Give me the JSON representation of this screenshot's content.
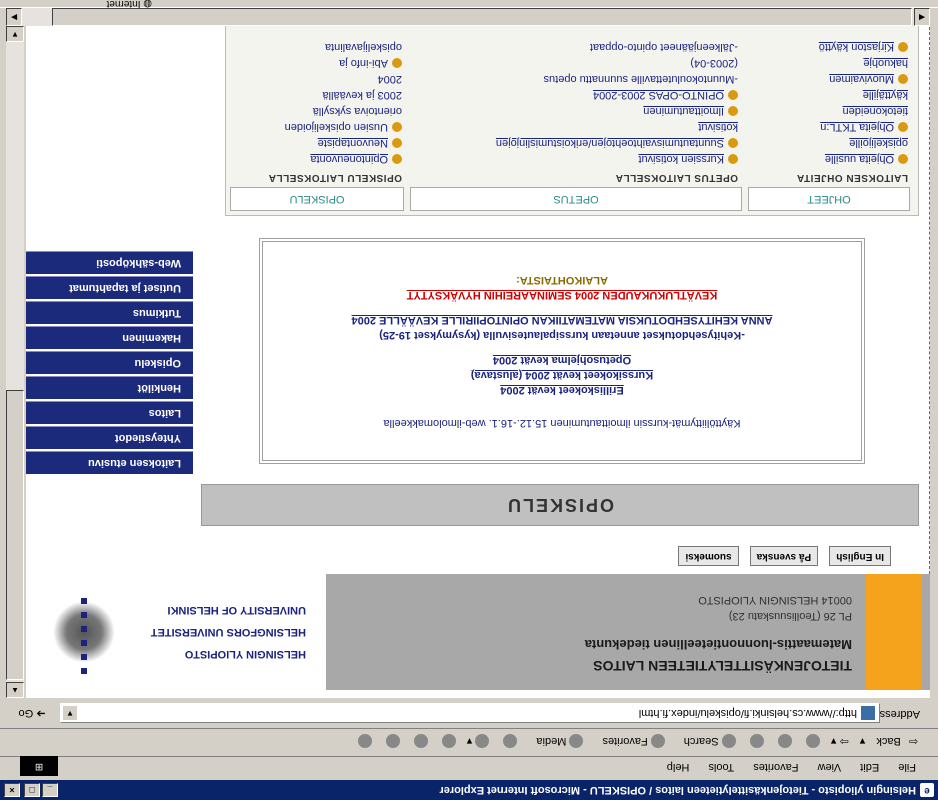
{
  "window": {
    "title": "Helsingin yliopisto - Tietojenkäsittelytieteen laitos / OPISKELU - Microsoft Internet Explorer",
    "min_label": "_",
    "max_label": "□",
    "close_label": "×"
  },
  "menubar": {
    "items": [
      "File",
      "Edit",
      "View",
      "Favorites",
      "Tools",
      "Help"
    ]
  },
  "toolbar": {
    "back": "Back",
    "search": "Search",
    "favorites": "Favorites",
    "media": "Media"
  },
  "address": {
    "label": "Address",
    "url": "http://www.cs.helsinki.fi/opiskelu/index.fi.html",
    "go": "Go"
  },
  "status": {
    "zone": "Internet"
  },
  "header": {
    "dept": "TIETOJENKÄSITTELYTIETEEN LAITOS",
    "faculty": "Matemaattis-luonnontieteellinen tiedekunta",
    "address_line1": "PL 26 (Teollisuuskatu 23)",
    "address_line2": "00014 HELSINGIN YLIOPISTO",
    "uni_fi": "HELSINGIN YLIOPISTO",
    "uni_sv": "HELSINGFORS UNIVERSITET",
    "uni_en": "UNIVERSITY OF HELSINKI"
  },
  "nav": {
    "items": [
      "Laitoksen etusivu",
      "Yhteystiedot",
      "Laitos",
      "Henkilöt",
      "Opiskelu",
      "Hakeminen",
      "Tutkimus",
      "Uutiset ja tapahtumat",
      "Web-sähköposti"
    ]
  },
  "languages": {
    "fi": "suomeksi",
    "sv": "På svenska",
    "en": "In English"
  },
  "page": {
    "banner": "OPISKELU"
  },
  "notice": {
    "heading": "ALAIKOHTAISTA:",
    "accepted": "KEVÄTLUKUKAUDEN 2004 SEMINAAREIHIN HYVÄKSYTYT",
    "dev_title": "ANNA KEHITYSEHDOTUKSIA MATEMATIIKAN OPINTOPIIRILLE KEVÄÄLLE 2004",
    "dev_sub": "-Kehitysehdotukset annetaan kurssipalautesivulla (kysymykset 19-25)",
    "schedule": "Opetusohjelma kevät 2004",
    "exams": "Kurssikokeet kevät 2004 (alustava)",
    "separate_exams": "Erilliskokeet kevät 2004",
    "registration": "Käyttöliittymät-kurssin ilmoittautuminen 15.12.-16.1. web-ilmolomakkeella"
  },
  "tabs": {
    "opiskelu": "OPISKELU",
    "opetus": "OPETUS",
    "ohjeet": "OHJEET"
  },
  "columns": {
    "study": {
      "heading": "OPISKELU LAITOKSELLA",
      "items": [
        "Opintoneuvonta",
        "Neuvontapiste",
        "Uusien opiskelijoiden",
        "orientoiva syksyllä",
        "2003 ja keväällä",
        "2004",
        "Abi-info ja",
        "opiskelijavalinta"
      ]
    },
    "teaching": {
      "heading": "OPETUS LAITOKSELLA",
      "items": [
        "Kurssien kotisivut",
        "Suuntautumisvaihtoehtojen/erikoistumislinjojen",
        "kotisivut",
        "Ilmoittautuminen",
        "OPINTO-OPAS 2003-2004",
        "-Muuntokoulutettaville suunnattu opetus",
        "(2003-04)",
        "-Jälkeenjääneet opinto-oppaat"
      ]
    },
    "guides": {
      "heading": "LAITOKSEN OHJEITA",
      "items": [
        "Ohjeita uusille",
        "opiskelijoille",
        "Ohjeita TKTL:n",
        "tietokoneiden",
        "käyttäjille",
        "Muovivaimen",
        "hakuohje",
        "Kirjaston käyttö"
      ]
    }
  }
}
